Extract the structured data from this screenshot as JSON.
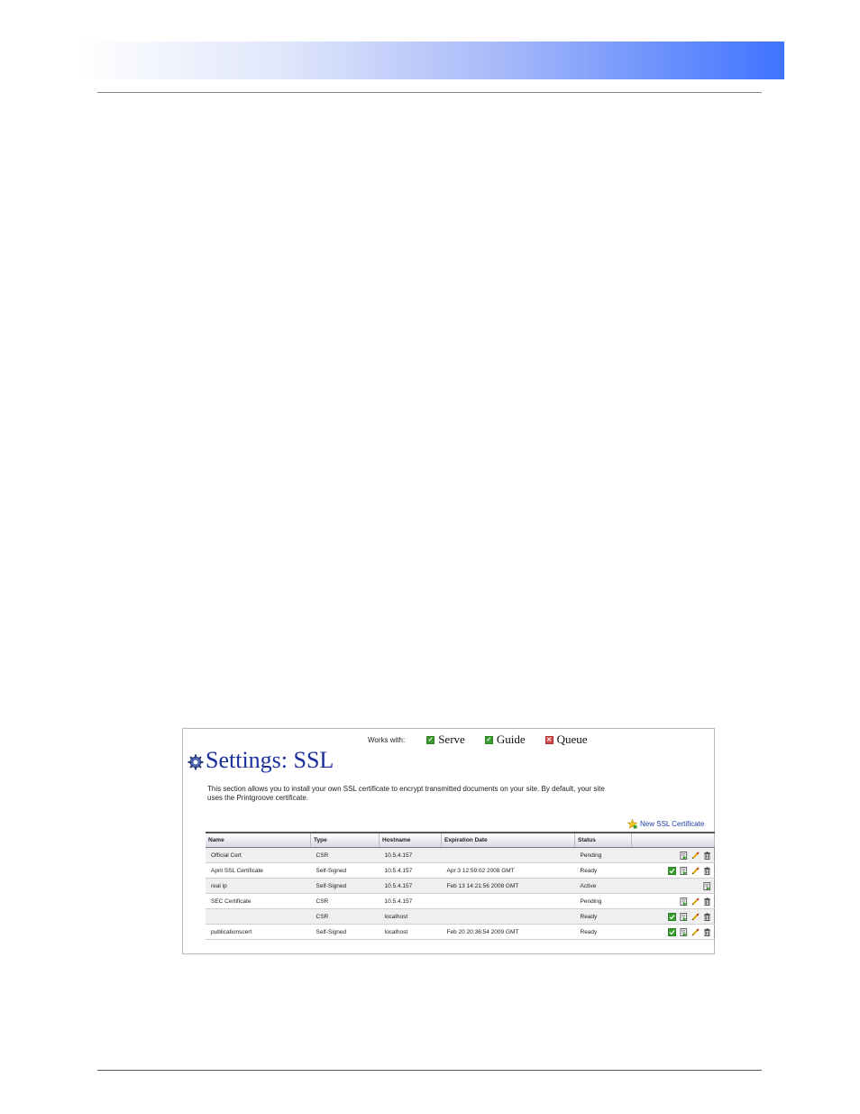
{
  "header": {},
  "screenshot": {
    "works_with": {
      "label": "Works with:",
      "products": [
        {
          "name": "Serve",
          "status": "check"
        },
        {
          "name": "Guide",
          "status": "check"
        },
        {
          "name": "Queue",
          "status": "cross"
        }
      ]
    },
    "title": "Settings: SSL",
    "description": "This section allows you to install your own SSL certificate to encrypt transmitted documents on your site. By default, your site uses the Printgroove certificate.",
    "new_link": "New SSL Certificate",
    "columns": [
      "Name",
      "Type",
      "Hostname",
      "Expiration Date",
      "Status",
      ""
    ],
    "rows": [
      {
        "name": "Official Cert",
        "type": "CSR",
        "hostname": "10.5.4.157",
        "expiration": "",
        "status": "Pending",
        "actions": [
          "install-icon",
          "edit-icon",
          "delete-icon"
        ]
      },
      {
        "name": "April SSL Certificate",
        "type": "Self-Signed",
        "hostname": "10.5.4.157",
        "expiration": "Apr 3 12:59:02 2008 GMT",
        "status": "Ready",
        "actions": [
          "activate-icon",
          "install-icon",
          "edit-icon",
          "delete-icon"
        ]
      },
      {
        "name": "real ip",
        "type": "Self-Signed",
        "hostname": "10.5.4.157",
        "expiration": "Feb 13 14:21:56 2008 GMT",
        "status": "Active",
        "actions": [
          "install-icon"
        ]
      },
      {
        "name": "SEC Certificate",
        "type": "CSR",
        "hostname": "10.5.4.157",
        "expiration": "",
        "status": "Pending",
        "actions": [
          "install-icon",
          "edit-icon",
          "delete-icon"
        ]
      },
      {
        "name": "",
        "type": "CSR",
        "hostname": "localhost",
        "expiration": "",
        "status": "Ready",
        "actions": [
          "activate-icon",
          "install-icon",
          "edit-icon",
          "delete-icon"
        ]
      },
      {
        "name": "publicationscert",
        "type": "Self-Signed",
        "hostname": "localhost",
        "expiration": "Feb 20 20:36:54 2009 GMT",
        "status": "Ready",
        "actions": [
          "activate-icon",
          "install-icon",
          "edit-icon",
          "delete-icon"
        ]
      }
    ]
  },
  "colors": {
    "title": "#1a2f9c",
    "link": "#1e3faa",
    "check": "#3a9b2e",
    "cross": "#d24a4a",
    "header_gradient_end": "#3f73ff"
  }
}
